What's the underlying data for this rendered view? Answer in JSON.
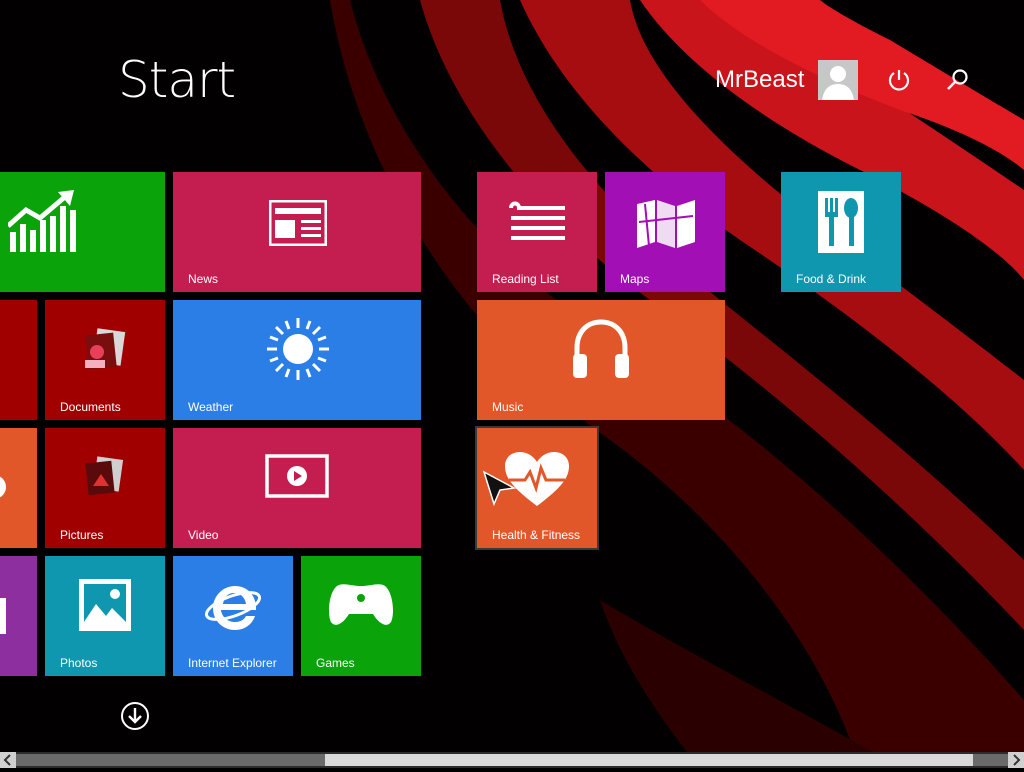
{
  "header": {
    "title": "Start",
    "user_name": "MrBeast"
  },
  "icons": {
    "power": "power-icon",
    "search": "search-icon",
    "scroll_down": "arrow-down-circle-icon"
  },
  "colors": {
    "green": "#0aa30a",
    "crimson": "#c41d4f",
    "dark_red": "#a10000",
    "blue": "#2a7ee6",
    "orange": "#e2572a",
    "purple": "#a20fb4",
    "teal": "#0f97b0",
    "violet": "#8e2fa0"
  },
  "tiles": {
    "finance": "",
    "news": "News",
    "documents": "Documents",
    "weather": "Weather",
    "pictures": "Pictures",
    "video": "Video",
    "photos": "Photos",
    "internet_explorer": "Internet Explorer",
    "games": "Games",
    "reading_list": "Reading List",
    "maps": "Maps",
    "music": "Music",
    "health_fitness": "Health & Fitness",
    "food_drink": "Food & Drink"
  }
}
